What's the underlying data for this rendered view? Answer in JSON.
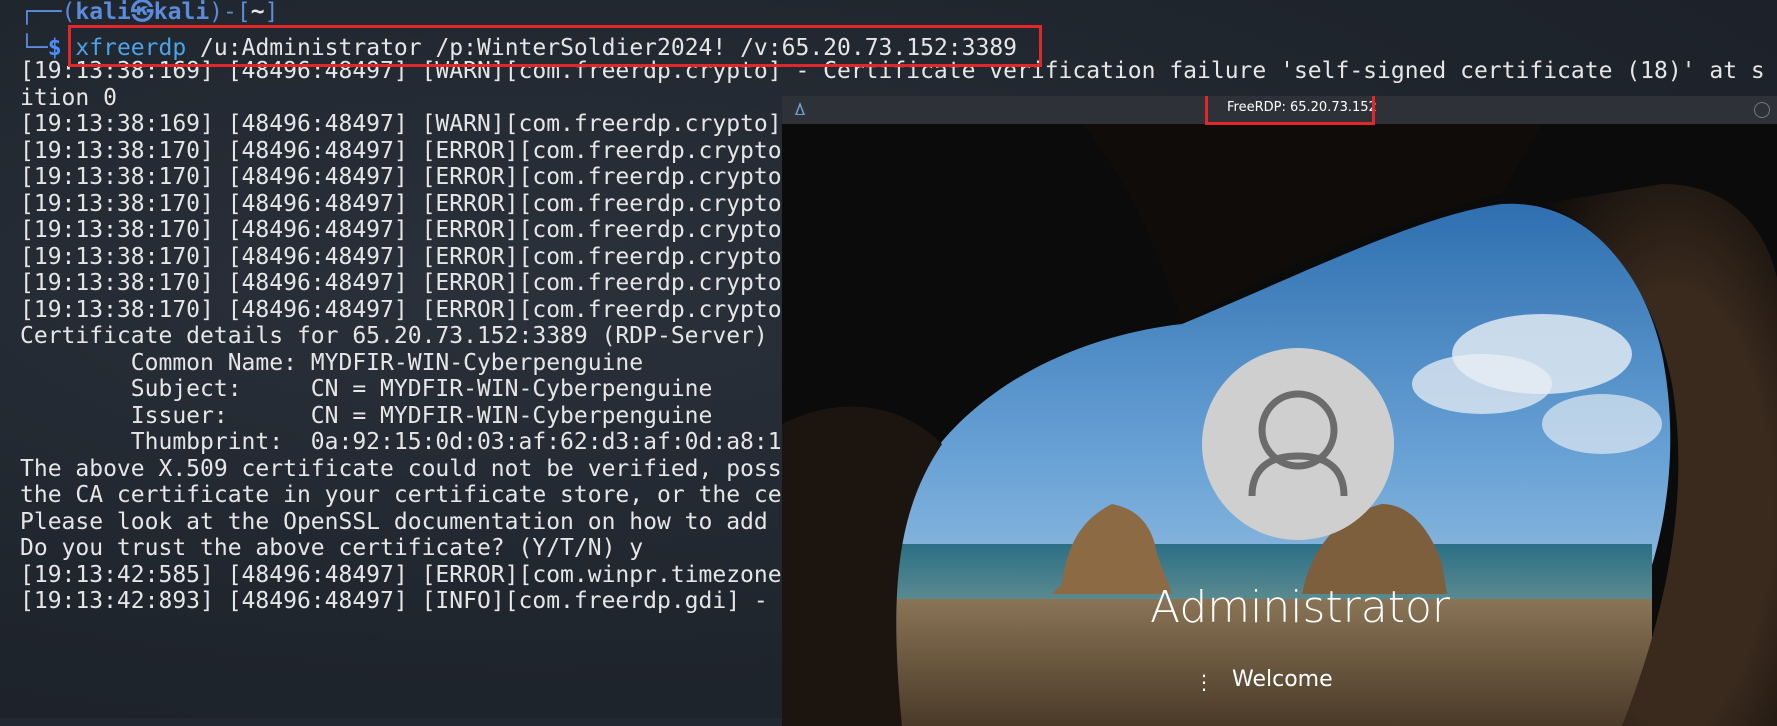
{
  "terminal": {
    "prompt": {
      "open": "┌──(",
      "user": "kali",
      "at": "㉿",
      "host": "kali",
      "close_dir_open": ")-[",
      "dir": "~",
      "close": "]",
      "corner": "└─",
      "dollar": "$"
    },
    "command": {
      "name": "xfreerdp",
      "args": " /u:Administrator /p:WinterSoldier2024! /v:65.20.73.152:3389"
    },
    "lines": [
      "[19:13:38:169] [48496:48497] [WARN][com.freerdp.crypto] - Certificate verification failure 'self-signed certificate (18)' at s",
      "ition 0",
      "[19:13:38:169] [48496:48497] [WARN][com.freerdp.crypto]",
      "[19:13:38:170] [48496:48497] [ERROR][com.freerdp.crypto",
      "[19:13:38:170] [48496:48497] [ERROR][com.freerdp.crypto",
      "[19:13:38:170] [48496:48497] [ERROR][com.freerdp.crypto",
      "[19:13:38:170] [48496:48497] [ERROR][com.freerdp.crypto",
      "[19:13:38:170] [48496:48497] [ERROR][com.freerdp.crypto",
      "[19:13:38:170] [48496:48497] [ERROR][com.freerdp.crypto",
      "[19:13:38:170] [48496:48497] [ERROR][com.freerdp.crypto",
      "Certificate details for 65.20.73.152:3389 (RDP-Server)",
      "        Common Name: MYDFIR-WIN-Cyberpenguine",
      "        Subject:     CN = MYDFIR-WIN-Cyberpenguine",
      "        Issuer:      CN = MYDFIR-WIN-Cyberpenguine",
      "        Thumbprint:  0a:92:15:0d:03:af:62:d3:af:0d:a8:1",
      "The above X.509 certificate could not be verified, poss",
      "the CA certificate in your certificate store, or the ce",
      "Please look at the OpenSSL documentation on how to add",
      "Do you trust the above certificate? (Y/T/N) y",
      "[19:13:42:585] [48496:48497] [ERROR][com.winpr.timezone",
      "[19:13:42:893] [48496:48497] [INFO][com.freerdp.gdi] -"
    ]
  },
  "rdp_window": {
    "title": "FreeRDP: 65.20.73.152",
    "username": "Administrator",
    "status": "Welcome",
    "status_dots": "⋮"
  },
  "colors": {
    "highlight_box": "#e12727",
    "command_name": "#4da3e8",
    "prompt_blue": "#5b8bd9"
  }
}
